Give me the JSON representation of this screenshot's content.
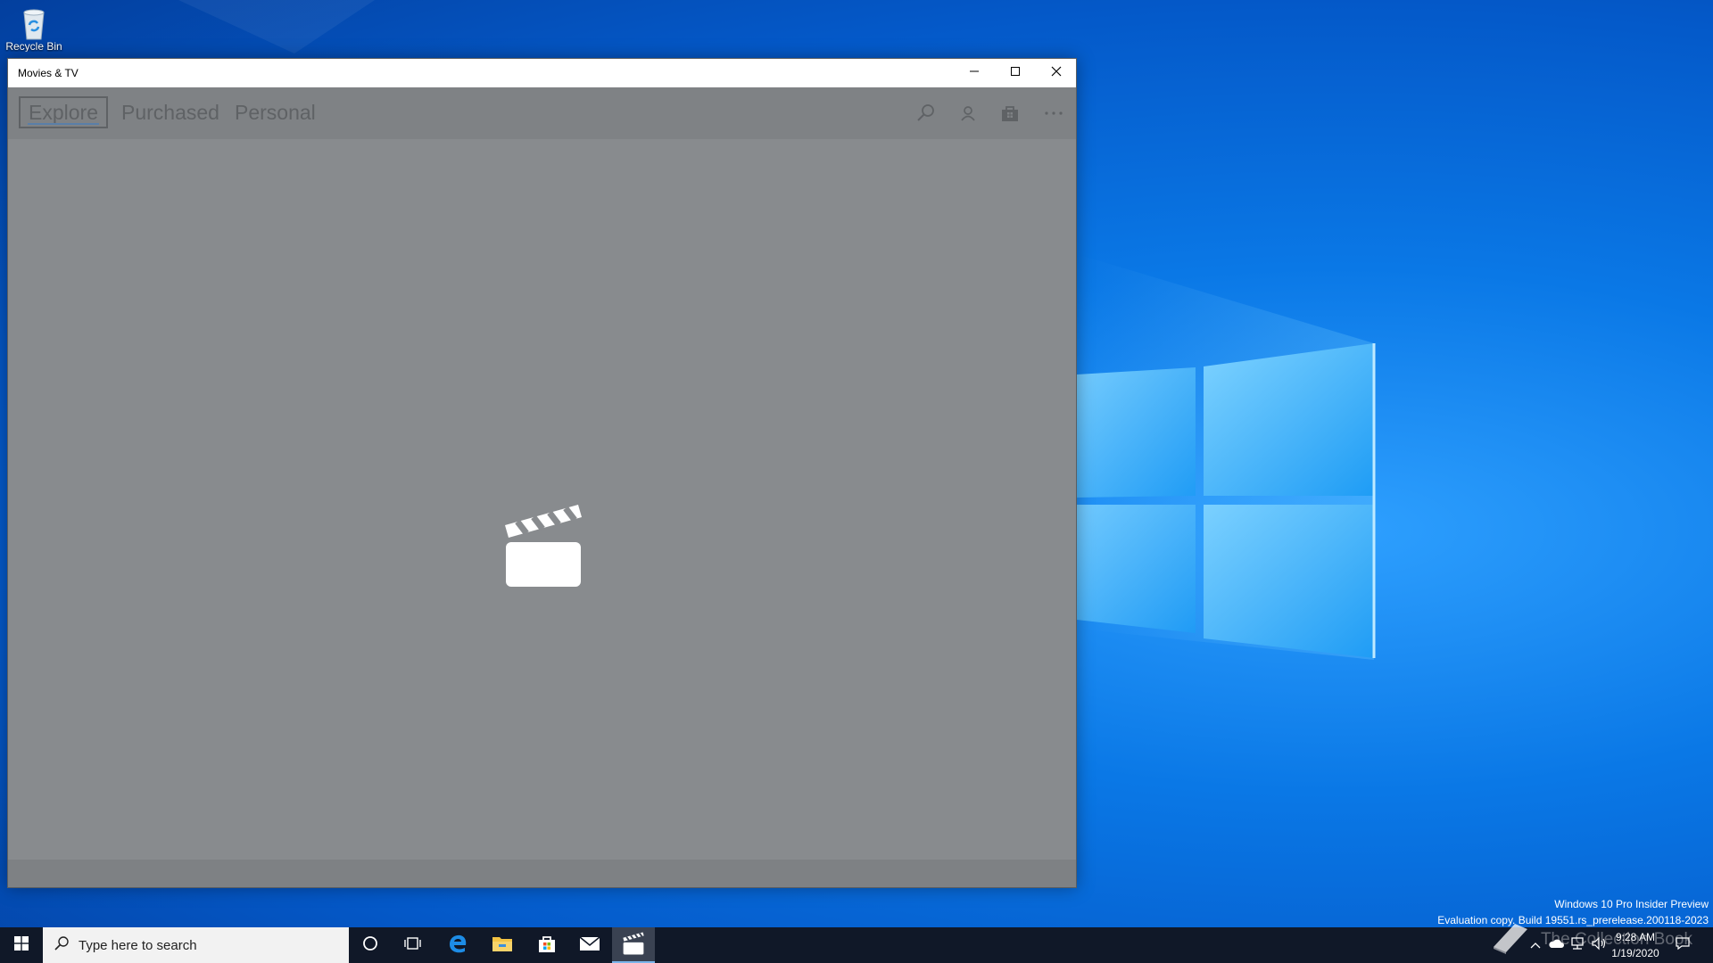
{
  "desktop": {
    "icons": [
      {
        "name": "Recycle Bin",
        "icon": "recycle-bin-icon"
      }
    ]
  },
  "window": {
    "title": "Movies & TV",
    "controls": {
      "minimize": "minimize-icon",
      "maximize": "maximize-icon",
      "close": "close-icon"
    },
    "tabs": [
      {
        "label": "Explore",
        "active": true
      },
      {
        "label": "Purchased",
        "active": false
      },
      {
        "label": "Personal",
        "active": false
      }
    ],
    "nav_icons": [
      "search-icon",
      "account-icon",
      "store-icon",
      "more-icon"
    ],
    "splash_icon": "clapperboard-icon"
  },
  "watermark": {
    "line1": "Windows 10 Pro Insider Preview",
    "line2": "Evaluation copy. Build 19551.rs_prerelease.200118-2023"
  },
  "taskbar": {
    "search_placeholder": "Type here to search",
    "pinned": [
      "cortana-icon",
      "task-view-icon",
      "edge-icon",
      "file-explorer-icon",
      "store-icon",
      "mail-icon",
      "movies-tv-icon"
    ],
    "active_app": "movies-tv-icon",
    "clock": {
      "time": "9:28 AM",
      "date": "1/19/2020"
    },
    "overlay_text": "The Collection Book"
  },
  "colors": {
    "app_background": "#888b8e",
    "taskbar": "#101828",
    "accent": "#0078d7"
  }
}
